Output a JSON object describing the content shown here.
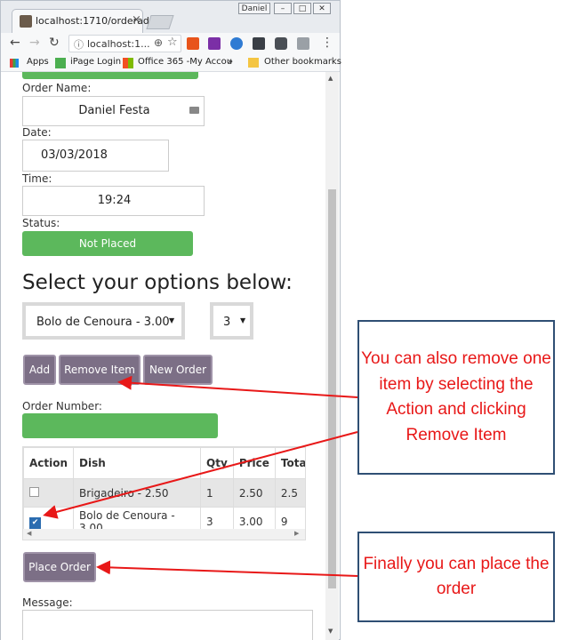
{
  "browser": {
    "tab_title": "localhost:1710/orderadd",
    "user": "Daniel",
    "address": "localhost:1...",
    "bookmarks": [
      "Apps",
      "iPage Login",
      "Office 365 -My Accou",
      "»",
      "Other bookmarks"
    ]
  },
  "form": {
    "order_name_label": "Order Name:",
    "order_name_value": "Daniel Festa",
    "date_label": "Date:",
    "date_value": "03/03/2018",
    "time_label": "Time:",
    "time_value": "19:24",
    "status_label": "Status:",
    "status_value": "Not Placed",
    "options_heading": "Select your options below:",
    "dish_select": "Bolo de Cenoura - 3.00",
    "qty_select": "3",
    "buttons": {
      "add": "Add",
      "remove": "Remove Item",
      "new_order": "New Order"
    },
    "order_number_label": "Order Number:",
    "place_order": "Place Order",
    "message_label": "Message:"
  },
  "table": {
    "headers": [
      "Action",
      "Dish",
      "Qty",
      "Price",
      "Total"
    ],
    "rows": [
      {
        "checked": false,
        "dish": "Brigadeiro - 2.50",
        "qty": "1",
        "price": "2.50",
        "total": "2.5"
      },
      {
        "checked": true,
        "dish": "Bolo de Cenoura - 3.00",
        "qty": "3",
        "price": "3.00",
        "total": "9"
      }
    ]
  },
  "annotations": {
    "remove_tip": "You can also remove one item by selecting the Action and clicking Remove Item",
    "place_tip": "Finally you can place the order"
  },
  "colors": {
    "accent": "#5cb85c",
    "button": "#7c6f86",
    "annotation_text": "#e81818",
    "annotation_border": "#2f4f74"
  }
}
